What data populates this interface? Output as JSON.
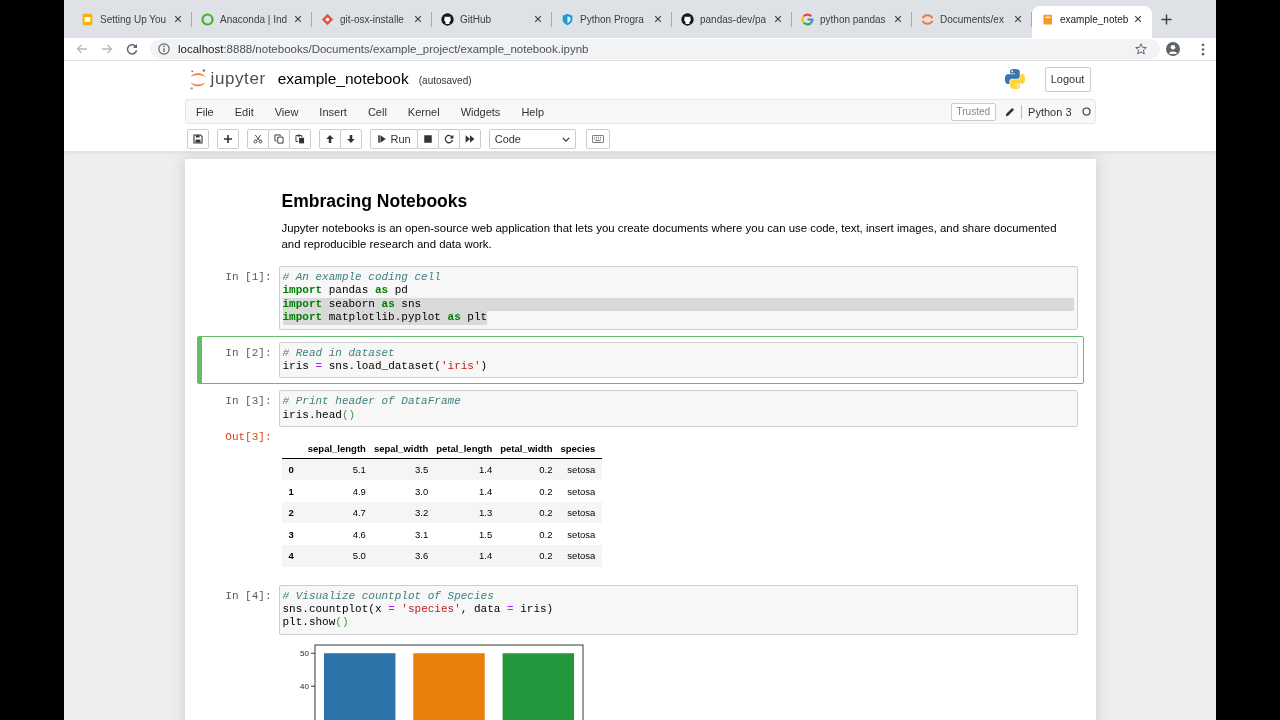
{
  "browser": {
    "tabs": [
      {
        "label": "Setting Up You",
        "selected": false
      },
      {
        "label": "Anaconda | Ind",
        "selected": false
      },
      {
        "label": "git-osx-installe",
        "selected": false
      },
      {
        "label": "GitHub",
        "selected": false
      },
      {
        "label": "Python Progra",
        "selected": false
      },
      {
        "label": "pandas-dev/pa",
        "selected": false
      },
      {
        "label": "python pandas",
        "selected": false
      },
      {
        "label": "Documents/ex",
        "selected": false
      },
      {
        "label": "example_noteb",
        "selected": true
      }
    ],
    "address": {
      "host": "localhost",
      "path": ":8888/notebooks/Documents/example_project/example_notebook.ipynb"
    }
  },
  "header": {
    "logo_text": "jupyter",
    "title": "example_notebook",
    "save_status": "(autosaved)",
    "logout": "Logout"
  },
  "menu": {
    "items": [
      "File",
      "Edit",
      "View",
      "Insert",
      "Cell",
      "Kernel",
      "Widgets",
      "Help"
    ],
    "trusted": "Trusted",
    "kernel": "Python 3",
    "kernel_busy": false
  },
  "toolbar": {
    "run": "Run",
    "cell_type": "Code"
  },
  "cells": [
    {
      "kind": "markdown",
      "selected": false,
      "heading": "Embracing Notebooks",
      "text": "Jupyter notebooks is an open-source web application that lets you create documents where you can use code, text, insert images, and share documented and reproducible research and data work."
    },
    {
      "kind": "code",
      "selected": false,
      "prompt": "In [1]:",
      "lines": [
        {
          "selected": false,
          "tokens": [
            {
              "kind": "comment",
              "text": "# An example coding cell"
            }
          ]
        },
        {
          "selected": false,
          "tokens": [
            {
              "kind": "keyword",
              "text": "import"
            },
            {
              "kind": "plain",
              "text": " pandas "
            },
            {
              "kind": "keyword",
              "text": "as"
            },
            {
              "kind": "plain",
              "text": " pd"
            }
          ]
        },
        {
          "selected": true,
          "tokens": [
            {
              "kind": "keyword",
              "text": "import"
            },
            {
              "kind": "plain",
              "text": " seaborn "
            },
            {
              "kind": "keyword",
              "text": "as"
            },
            {
              "kind": "plain",
              "text": " sns"
            }
          ]
        },
        {
          "selected": true,
          "tokens": [
            {
              "kind": "keyword",
              "text": "import"
            },
            {
              "kind": "plain",
              "text": " matplotlib.pyplot "
            },
            {
              "kind": "keyword",
              "text": "as"
            },
            {
              "kind": "plain",
              "text": " plt"
            }
          ]
        }
      ]
    },
    {
      "kind": "code",
      "selected": true,
      "prompt": "In [2]:",
      "lines": [
        {
          "selected": false,
          "tokens": [
            {
              "kind": "comment",
              "text": "# Read in dataset"
            }
          ]
        },
        {
          "selected": false,
          "tokens": [
            {
              "kind": "plain",
              "text": "iris "
            },
            {
              "kind": "operator",
              "text": "="
            },
            {
              "kind": "plain",
              "text": " sns.load_dataset("
            },
            {
              "kind": "string",
              "text": "'iris'"
            },
            {
              "kind": "plain",
              "text": ")"
            }
          ]
        }
      ]
    },
    {
      "kind": "code",
      "selected": false,
      "prompt": "In [3]:",
      "lines": [
        {
          "selected": false,
          "tokens": [
            {
              "kind": "comment",
              "text": "# Print header of DataFrame"
            }
          ]
        },
        {
          "selected": false,
          "tokens": [
            {
              "kind": "plain",
              "text": "iris.head"
            },
            {
              "kind": "paren",
              "text": "()"
            }
          ]
        }
      ],
      "output": {
        "prompt": "Out[3]:",
        "table": {
          "columns": [
            "sepal_length",
            "sepal_width",
            "petal_length",
            "petal_width",
            "species"
          ],
          "rows": [
            {
              "index": "0",
              "values": [
                "5.1",
                "3.5",
                "1.4",
                "0.2",
                "setosa"
              ]
            },
            {
              "index": "1",
              "values": [
                "4.9",
                "3.0",
                "1.4",
                "0.2",
                "setosa"
              ]
            },
            {
              "index": "2",
              "values": [
                "4.7",
                "3.2",
                "1.3",
                "0.2",
                "setosa"
              ]
            },
            {
              "index": "3",
              "values": [
                "4.6",
                "3.1",
                "1.5",
                "0.2",
                "setosa"
              ]
            },
            {
              "index": "4",
              "values": [
                "5.0",
                "3.6",
                "1.4",
                "0.2",
                "setosa"
              ]
            }
          ]
        }
      }
    },
    {
      "kind": "code",
      "selected": false,
      "prompt": "In [4]:",
      "lines": [
        {
          "selected": false,
          "tokens": [
            {
              "kind": "comment",
              "text": "# Visualize countplot of Species"
            }
          ]
        },
        {
          "selected": false,
          "tokens": [
            {
              "kind": "plain",
              "text": "sns.countplot(x "
            },
            {
              "kind": "operator",
              "text": "="
            },
            {
              "kind": "string",
              "text": " 'species'"
            },
            {
              "kind": "plain",
              "text": ", data "
            },
            {
              "kind": "operator",
              "text": "="
            },
            {
              "kind": "plain",
              "text": " iris)"
            }
          ]
        },
        {
          "selected": false,
          "tokens": [
            {
              "kind": "plain",
              "text": "plt.show"
            },
            {
              "kind": "paren",
              "text": "()"
            }
          ]
        }
      ],
      "output": {
        "chart_data": {
          "type": "bar",
          "values": [
            50,
            50,
            50
          ],
          "colors": [
            "#2b74a9",
            "#e8810b",
            "#24963b"
          ],
          "ylim": [
            0,
            52.5
          ],
          "yticks": [
            40,
            50
          ]
        }
      }
    }
  ]
}
